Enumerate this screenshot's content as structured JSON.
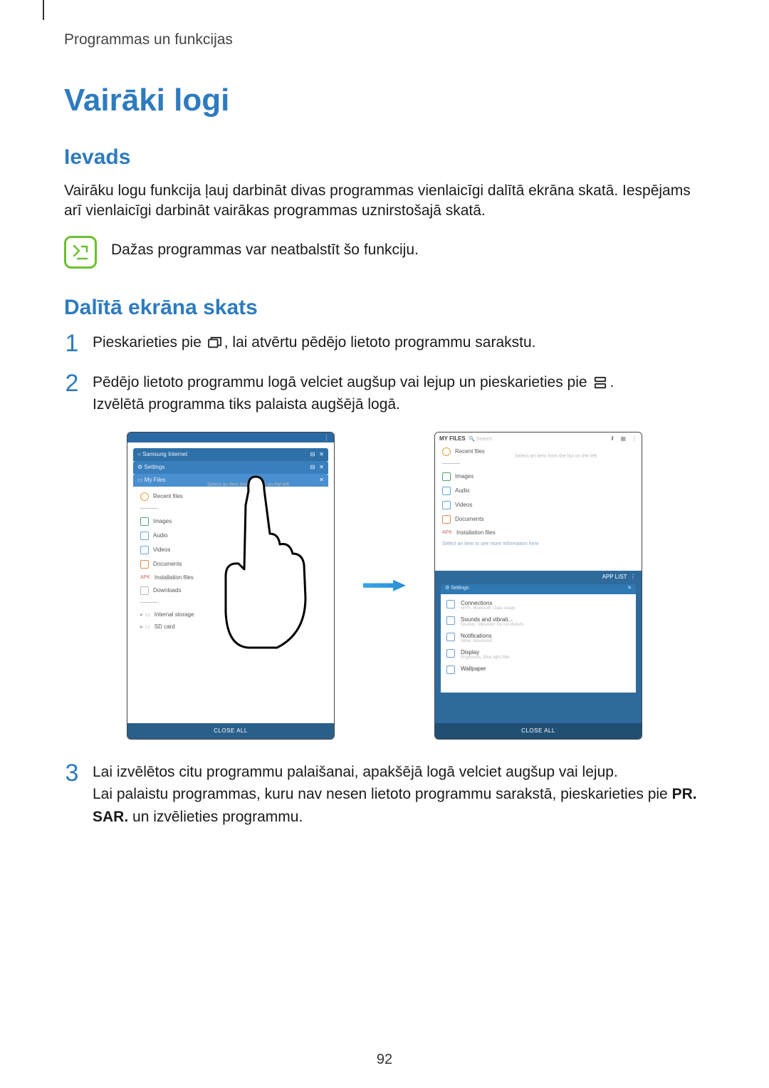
{
  "header": {
    "breadcrumb": "Programmas un funkcijas"
  },
  "title": "Vairāki logi",
  "section_intro": {
    "heading": "Ievads",
    "body": "Vairāku logu funkcija ļauj darbināt divas programmas vienlaicīgi dalītā ekrāna skatā. Iespējams arī vienlaicīgi darbināt vairākas programmas uznirstošajā skatā.",
    "note": "Dažas programmas var neatbalstīt šo funkciju."
  },
  "section_split": {
    "heading": "Dalītā ekrāna skats",
    "steps": {
      "1": {
        "before": "Pieskarieties pie",
        "after": ", lai atvērtu pēdējo lietoto programmu sarakstu."
      },
      "2": {
        "before": "Pēdējo lietoto programmu logā velciet augšup vai lejup un pieskarieties pie",
        "after": ".",
        "line2": "Izvēlētā programma tiks palaista augšējā logā."
      },
      "3": {
        "line1": "Lai izvēlētos citu programmu palaišanai, apakšējā logā velciet augšup vai lejup.",
        "line2_a": "Lai palaistu programmas, kuru nav nesen lietoto programmu sarakstā, pieskarieties pie ",
        "line2_b": "PR. SAR.",
        "line2_c": " un izvēlieties programmu."
      }
    }
  },
  "mock_left": {
    "cards": [
      "Samsung Internet",
      "Settings",
      "My Files"
    ],
    "files_header": "MY FILES",
    "items": [
      "Recent files",
      "Images",
      "Audio",
      "Videos",
      "Documents",
      "Installation files",
      "Downloads"
    ],
    "storage": [
      "Internal storage",
      "SD card"
    ],
    "placeholder": "Select an item from the list on the left",
    "close": "CLOSE ALL"
  },
  "mock_right": {
    "top_title": "MY FILES",
    "search": "Search",
    "items": [
      "Recent files",
      "Images",
      "Audio",
      "Videos",
      "Documents",
      "Installation files"
    ],
    "placeholder": "Select an item from the list on the left",
    "hint": "Select an item to see more information here",
    "bottom_header": "APP LIST",
    "settings_card": "Settings",
    "settings": [
      {
        "t": "Connections",
        "s": "Wi-Fi, Bluetooth, Data usage"
      },
      {
        "t": "Sounds and vibrati...",
        "s": "Sounds, Vibration, Do not disturb"
      },
      {
        "t": "Notifications",
        "s": "Allow, Advanced"
      },
      {
        "t": "Display",
        "s": "Brightness, Blue light filter"
      },
      {
        "t": "Wallpaper",
        "s": ""
      }
    ],
    "close": "CLOSE ALL"
  },
  "page_number": "92"
}
